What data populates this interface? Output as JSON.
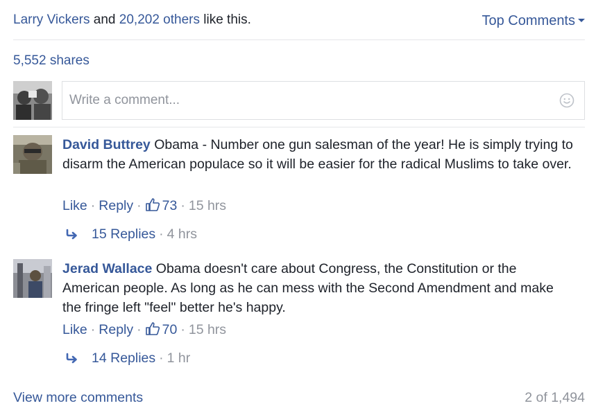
{
  "likes": {
    "first_name": "Larry Vickers",
    "and_text": "and",
    "others_link": "20,202 others",
    "suffix": "like this."
  },
  "sort_menu": {
    "label": "Top Comments"
  },
  "shares": {
    "label": "5,552 shares"
  },
  "composer": {
    "placeholder": "Write a comment..."
  },
  "comments": [
    {
      "author": "David Buttrey",
      "text": "Obama - Number one gun salesman of the year! He is simply trying to disarm the American populace so it will be easier for the radical Muslims to take over.",
      "like_label": "Like",
      "reply_label": "Reply",
      "like_count": "73",
      "time": "15 hrs",
      "replies_label": "15 Replies",
      "replies_time": "4 hrs"
    },
    {
      "author": "Jerad Wallace",
      "text": "Obama doesn't care about Congress, the Constitution or the American people. As long as he can mess with the Second Amendment and make the fringe left \"feel\" better he's happy.",
      "like_label": "Like",
      "reply_label": "Reply",
      "like_count": "70",
      "time": "15 hrs",
      "replies_label": "14 Replies",
      "replies_time": "1 hr"
    }
  ],
  "footer": {
    "view_more": "View more comments",
    "count": "2 of 1,494"
  },
  "colors": {
    "link": "#365899",
    "muted": "#90949c",
    "text": "#1d2129",
    "divider": "#e5e6e9"
  }
}
